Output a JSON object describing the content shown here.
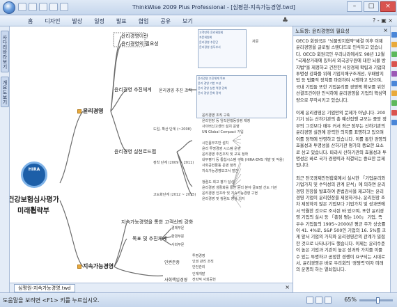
{
  "window": {
    "title": "ThinkWise 2009 Plus Professional - [심평원-지속가능경영.twd]",
    "buttons": {
      "minimize": "–",
      "maximize": "□",
      "close": "×"
    }
  },
  "ribbon": {
    "tabs": [
      "홈",
      "디자인",
      "발상",
      "일정",
      "발표",
      "협업",
      "공유",
      "보기"
    ],
    "right_help": "? - ▣ ×",
    "mid_icon": "♣"
  },
  "left_panel": {
    "tabs": [
      "사다리바라보기",
      "개요도보기"
    ]
  },
  "mindmap": {
    "center": {
      "logo": "HIRA",
      "title_line1": "건강보험심사평가원",
      "title_line2": "미래전략부"
    },
    "top_nodes": [
      "윤리경영이란",
      "윤리경영의 필요성"
    ],
    "main_topics": [
      "윤리경영",
      "지속가능경영"
    ],
    "ethics_branches": [
      "윤리경영 추진체계",
      "윤리경영 실천로드맵"
    ],
    "system_sub": "윤리경영 추진 조직",
    "roadmap_phases": [
      "도입, 확산 단계 (~2008)",
      "정착 단계 (2009 ~ 2011)",
      "고도화단계 (2012 ~ 2015)"
    ],
    "phase1_items": [
      "윤리경영 조직 구축",
      "윤리헌장 등 임직원행동강령 제정",
      "사이버신고센터 설치 운영",
      "UN Global Compact 가입"
    ],
    "phase2_items": [
      "시민옴부즈만 설치",
      "윤리 투명경영 시스템 운영",
      "윤리경영 추진조직 및 교육 정착",
      "내부평가 등 통합시스템 구축 (HIRA-EMS 개발 및 적용)",
      "사회공헌활동 운영 정착",
      "지속가능경영보고서 발간"
    ],
    "phase3_items": [
      "청렴도 최고 평가 달성",
      "윤리경영 생활화를 통한 윤리 분야 글로벌 선도 기관",
      "윤리경영 인프라 및 지속가능경영 구현",
      "윤리경영 및 청렴도 향상 의지"
    ],
    "sustain_branches": [
      "지속가능경영을 통한 고객신뢰 강화",
      "목표 및 추진체계"
    ],
    "sustain_sub": [
      "경제부문",
      "환경부문",
      "사회부문"
    ],
    "sustain_bottom": [
      "인권존중",
      "사회책임경영"
    ],
    "human_rights_items": [
      "투명경영",
      "인권 관리 조직",
      "안전관리"
    ],
    "social_items": [
      "인재개발",
      "전략적 사회공헌"
    ],
    "thumb1": [
      "고객만족 윤리위원회",
      "자문위원회",
      "윤리경영 추진단",
      "윤리경영 실무부서"
    ],
    "thumb1_side": "자문",
    "thumb2": [
      "윤리경영 추진체계 목표",
      "윤리 경영 기반 조성",
      "윤리 경영 실천 역량 강화",
      "윤리 경영 문화 정착"
    ]
  },
  "doc_tab": {
    "label": "심평원-지속가능경영.twd",
    "close": "×"
  },
  "notes": {
    "title": "노트창: 윤리경영의 필요성",
    "close": "×",
    "paragraphs": [
      "OECD 회원국은 \"뇌물방지협약\"체결 이후 이제 윤리경영을 글로벌 스탠다드로 인식하고 있습니다. OECD 회원국인 우리나라에서도 98년 12월 \"국제상거래에 있어서 외국공무원에 대한 뇌물 방지법\"을 제정하고 건전한 시장경제 확립과 기업의 투명성 강화를 위해 기업지배구조개선, 부패방지법 등 법률적 장치를 마련하여 시행하고 있으며, 국내 기업들 또한 기업윤리를 경영책 확보를 위한 선결조건이란 인식하에 윤리경영을 기업의 핵심역량으로 부각시키고 있습니다.",
      "이제 윤리경영은 기업만의 문제가 아닙니다. 200기기 넘는 산하기관의 총 예산집행 규모는 중앙 정부의 그것보다 매우 커서 최근 정부는 산하기관의 윤리경영 실천에 강력한 의지를 표명하고 있으며 이를 정책에 반영하고 있습니다. 이를 통한 경영의 효율성과 투명성을 산하기관 평가의 중요한 요소로 삼고 있습니다. 따라서 산하기관의 효율성과 투명성은 바로 국가 경쟁력과 직결되는 중요한 문제입니다.",
      "최근 전국경제인연합회에서 실시한 「기업윤리와 기업가치 및 수익성의 관계 분석」에 의하면 윤리경영 헌장을 발표하여 준법감사을 제고하는 윤리경영 기업이 윤리헌장을 제정하거나, 윤리헌장 조차 제정하지 않은 기업보다 기업가치 및 성과면에서 탁월한 것으로 조사된 바 있으며, 또한 윤리경영 기업의 실시 등 「총점 평는 100」 기업, 즉 우수 기업들의 1995~2000년 평균 주가 상승률이 41. 4%로, S&P 500인 기업의 16. 5%를 크게 앞서 기업의 가치와 윤리경영간의 관계가 밀접한 것으로 나타나기도 했습니다. 이제는 윤리수준이 높은 기업과 기관이 높은 성과와 가치를 이룰 수 있는 투명하고 공정한 경쟁이 요구되는 시대로서, 윤리경영은 바로 우리회의 '경쟁력'이자 미래의 운명의 하는 열쇠입니다."
    ]
  },
  "statusbar": {
    "text": "도움말을 보려면 <F1> 키를 누르십시오.",
    "zoom": "65%",
    "zoom_fraction": 0.55
  },
  "colors": {
    "titlebar": "#c5d6ec",
    "branch_line": "#6b6b6b",
    "logo": "#1d5fa8",
    "notes_header": "#d6e3f3"
  },
  "icons": {
    "app": "app-orb-icon",
    "notes_close": "close-icon",
    "doc_close": "close-icon",
    "topic_bullet": "folder-icon"
  }
}
